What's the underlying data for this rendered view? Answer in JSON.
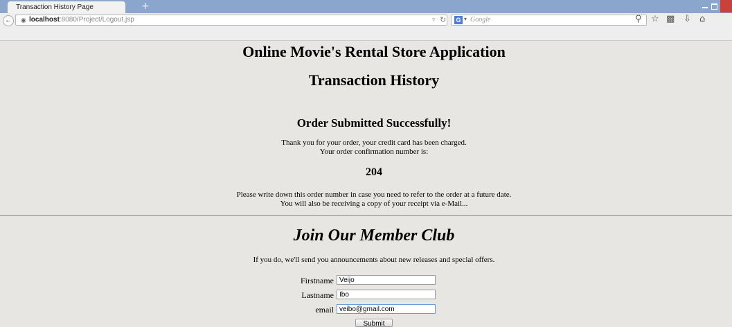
{
  "browser": {
    "tab_title": "Transaction History Page",
    "new_tab": "+",
    "url_host": "localhost",
    "url_rest": ":8080/Project/Logout.jsp",
    "search_engine": "G",
    "search_placeholder": "Google"
  },
  "page": {
    "store_title": "Online Movie's Rental Store Application",
    "page_title": "Transaction History",
    "success_heading": "Order Submitted Successfully!",
    "thanks_line1": "Thank you for your order, your credit card has been charged.",
    "thanks_line2": "Your order confirmation number is:",
    "order_number": "204",
    "note_line1": "Please write down this order number in case you need to refer to the order at a future date.",
    "note_line2": "You will also be receiving a copy of your receipt via e-Mail...",
    "join_heading": "Join Our Member Club",
    "join_text": "If you do, we'll send you announcements about new releases and special offers."
  },
  "form": {
    "firstname_label": "Firstname",
    "firstname_value": "Veijo",
    "lastname_label": "Lastname",
    "lastname_value": "Ibo",
    "email_label": "email",
    "email_value": "veibo@gmail.com",
    "submit_label": "Submit"
  },
  "colors": {
    "page_bg": "#e8e6e2",
    "titlebar": "#8aa6cc",
    "close_button": "#c9413b"
  }
}
